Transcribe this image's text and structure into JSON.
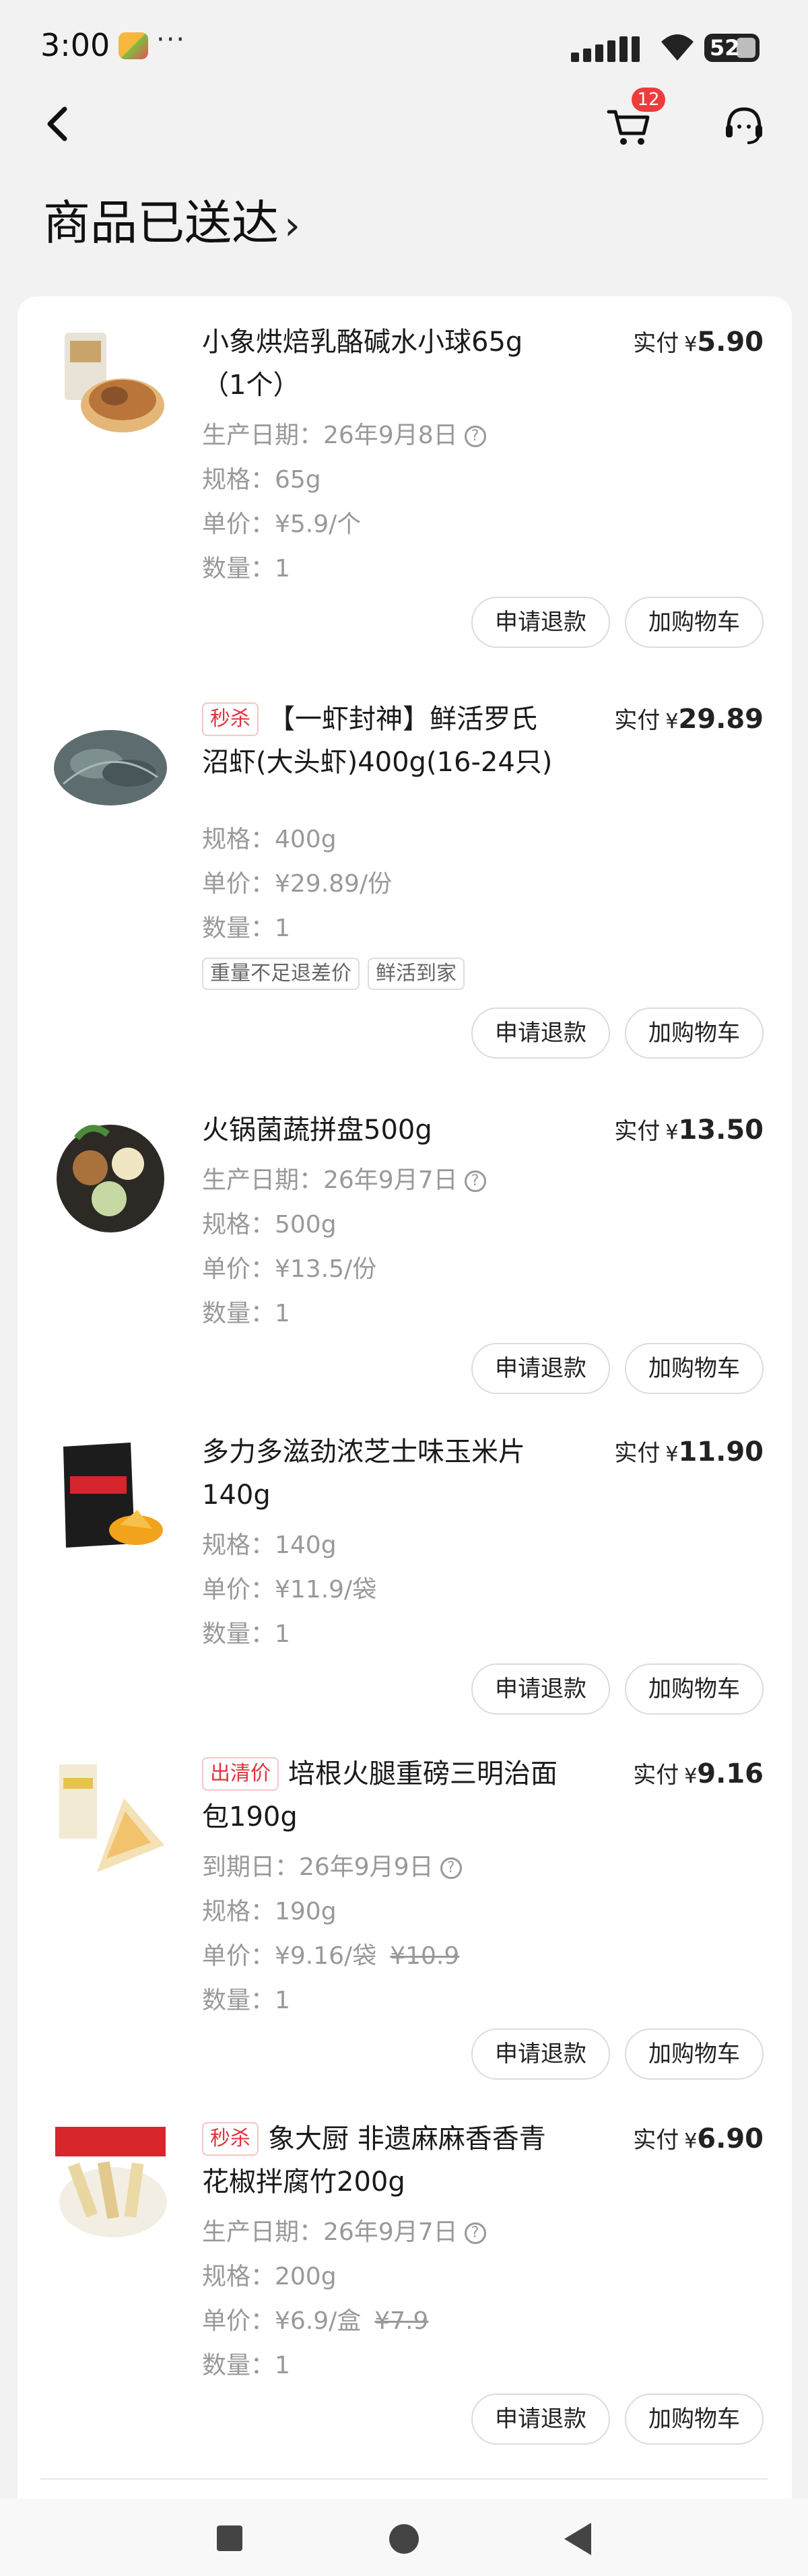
{
  "status_bar": {
    "time": "3:00",
    "extra": "···",
    "battery": "52"
  },
  "nav": {
    "cart_badge": "12",
    "icons": [
      "back-icon",
      "cart-icon",
      "customer-service-icon"
    ]
  },
  "page_title": "商品已送达",
  "paid_label": "实付",
  "currency": "¥",
  "actions": {
    "refund": "申请退款",
    "add_cart": "加购物车"
  },
  "items": [
    {
      "name": "小象烘焙乳酪碱水小球65g（1个）",
      "tag": "",
      "price": "5.90",
      "date": "生产日期：26年9月8日",
      "spec": "规格：65g",
      "unit_price": "单价：¥5.9/个",
      "original_price": "",
      "quantity": "数量：1",
      "chips": []
    },
    {
      "name": "【一虾封神】鲜活罗氏沼虾(大头虾)400g(16-24只)",
      "tag": "秒杀",
      "price": "29.89",
      "date": "",
      "spec": "规格：400g",
      "unit_price": "单价：¥29.89/份",
      "original_price": "",
      "quantity": "数量：1",
      "chips": [
        "重量不足退差价",
        "鲜活到家"
      ]
    },
    {
      "name": "火锅菌蔬拼盘500g",
      "tag": "",
      "price": "13.50",
      "date": "生产日期：26年9月7日",
      "spec": "规格：500g",
      "unit_price": "单价：¥13.5/份",
      "original_price": "",
      "quantity": "数量：1",
      "chips": []
    },
    {
      "name": "多力多滋劲浓芝士味玉米片140g",
      "tag": "",
      "price": "11.90",
      "date": "",
      "spec": "规格：140g",
      "unit_price": "单价：¥11.9/袋",
      "original_price": "",
      "quantity": "数量：1",
      "chips": []
    },
    {
      "name": "培根火腿重磅三明治面包190g",
      "tag": "出清价",
      "price": "9.16",
      "date": "到期日：26年9月9日",
      "spec": "规格：190g",
      "unit_price": "单价：¥9.16/袋",
      "original_price": "¥10.9",
      "quantity": "数量：1",
      "chips": []
    },
    {
      "name": "象大厨 非遗麻麻香香青花椒拌腐竹200g",
      "tag": "秒杀",
      "price": "6.90",
      "date": "生产日期：26年9月7日",
      "spec": "规格：200g",
      "unit_price": "单价：¥6.9/盒",
      "original_price": "¥7.9",
      "quantity": "数量：1",
      "chips": []
    }
  ]
}
